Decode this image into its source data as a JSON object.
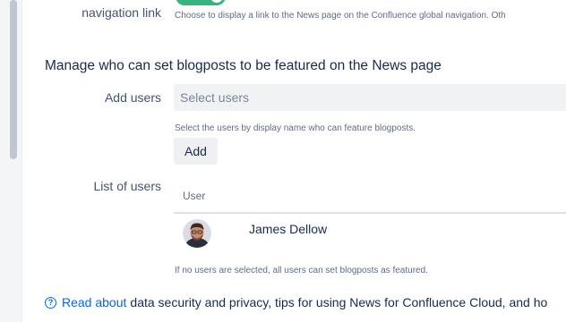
{
  "navigation": {
    "label": "navigation link",
    "help_text": "Choose to display a link to the News page on the Confluence global navigation. Oth"
  },
  "featured": {
    "heading": "Manage who can set blogposts to be featured on the News page",
    "add_users_label": "Add users",
    "select_placeholder": "Select users",
    "select_help": "Select the users by display name who can feature blogposts.",
    "add_button": "Add",
    "list_label": "List of users",
    "table_header_user": "User",
    "users": [
      {
        "name": "James Dellow"
      }
    ],
    "footnote": "If no users are selected, all users can set blogposts as featured."
  },
  "footer": {
    "link_text": "Read about",
    "text": "data security and privacy, tips for using News for Confluence Cloud, and ho"
  },
  "colors": {
    "toggle_on": "#36b37e",
    "link": "#0c66e4"
  },
  "icons": {
    "help": "question-circle-icon"
  }
}
